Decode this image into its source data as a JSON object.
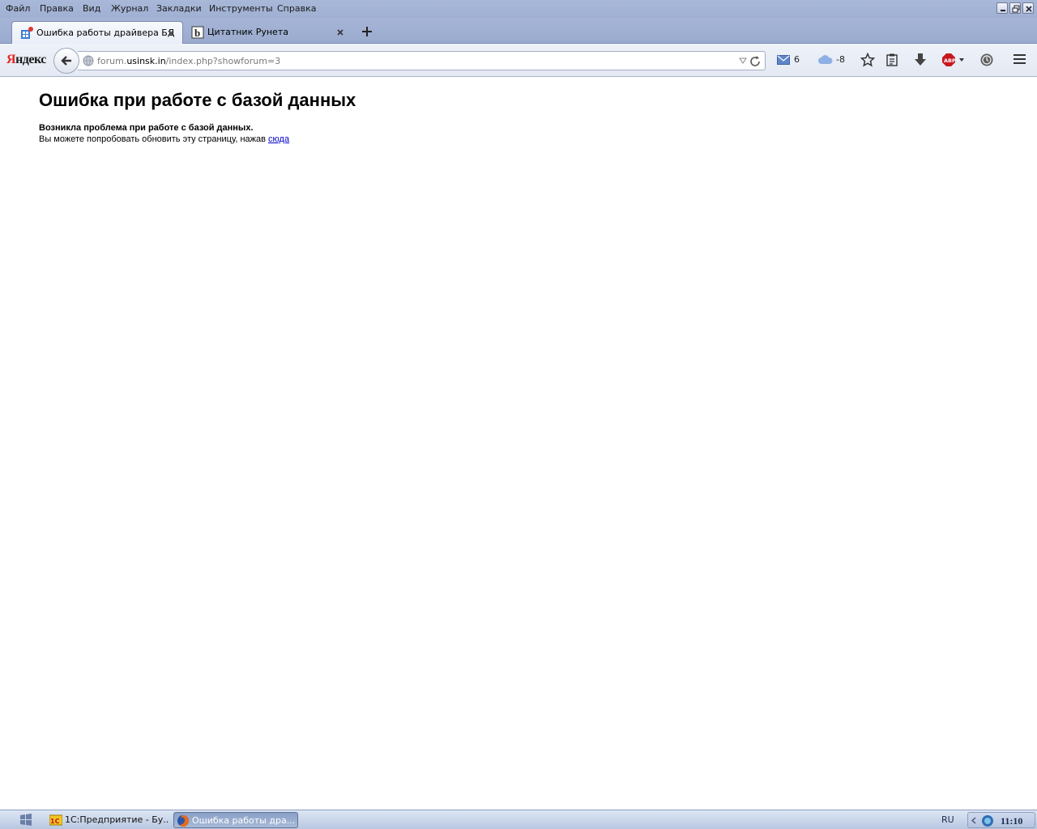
{
  "menubar": {
    "items": [
      "Файл",
      "Правка",
      "Вид",
      "Журнал",
      "Закладки",
      "Инструменты",
      "Справка"
    ]
  },
  "tabs": [
    {
      "title": "Ошибка работы драйвера БД",
      "active": true
    },
    {
      "title": "Цитатник Рунета",
      "active": false
    }
  ],
  "navbar": {
    "logo_ya": "Я",
    "logo_rest": "ндекс",
    "url_prefix": "forum.",
    "url_host": "usinsk.in",
    "url_path": "/index.php?showforum=3",
    "mail_count": "6",
    "weather_temp": "-8"
  },
  "page": {
    "heading": "Ошибка при работе с базой данных",
    "error_title": "Возникла проблема при работе с базой данных.",
    "error_text": "Вы можете попробовать обновить эту страницу, нажав ",
    "error_link": "сюда"
  },
  "taskbar": {
    "tasks": [
      {
        "label": "1С:Предприятие - Бу...",
        "active": false
      },
      {
        "label": "Ошибка работы дра...",
        "active": true
      }
    ],
    "language": "RU",
    "clock": "11:10"
  },
  "colors": {
    "accent": "#9fb0d3",
    "link": "#0000cc",
    "yandex_red": "#e52620"
  }
}
